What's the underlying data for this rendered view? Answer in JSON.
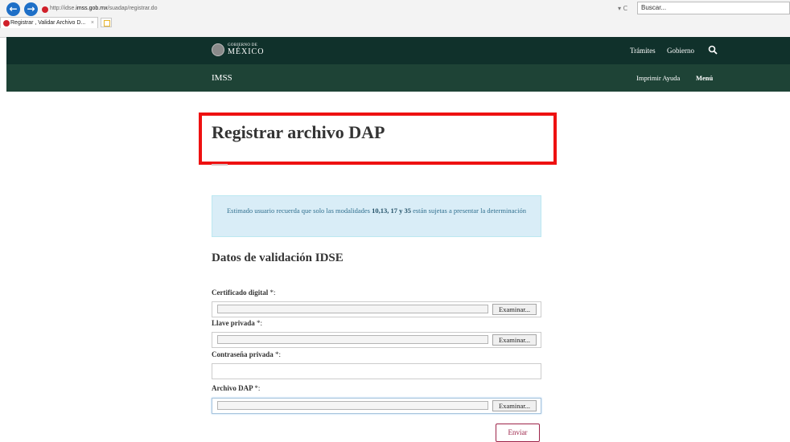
{
  "browser": {
    "url_prefix": "http://idse.",
    "url_domain": "imss.gob.mx",
    "url_path": "/suadap/registrar.do",
    "url_controls": "▾ C",
    "search_placeholder": "Buscar...",
    "tab_title": "Registrar , Validar Archivo D...",
    "tab_close": "×"
  },
  "gob_header": {
    "logo_top": "GOBIERNO DE",
    "logo_bottom": "MÉXICO",
    "nav": [
      "Trámites",
      "Gobierno"
    ]
  },
  "imss_header": {
    "title": "IMSS",
    "print_help": "Imprimir Ayuda",
    "menu": "Menú"
  },
  "page": {
    "title": "Registrar archivo DAP",
    "alert_pre": "Estimado usuario recuerda que solo las modalidades ",
    "alert_bold": "10,13, 17 y 35",
    "alert_post": " están sujetas a presentar la determinación",
    "section_title": "Datos de validación IDSE"
  },
  "form": {
    "cert_label": "Certificado digital",
    "key_label": "Llave privada",
    "password_label": "Contraseña privada",
    "dap_label": "Archivo DAP",
    "required_mark": "*:",
    "browse_label": "Examinar...",
    "submit_label": "Enviar"
  },
  "colors": {
    "gob_green": "#10312b",
    "imss_green": "#1e4336",
    "highlight_red": "#ee1111",
    "submit_accent": "#9d2449"
  }
}
